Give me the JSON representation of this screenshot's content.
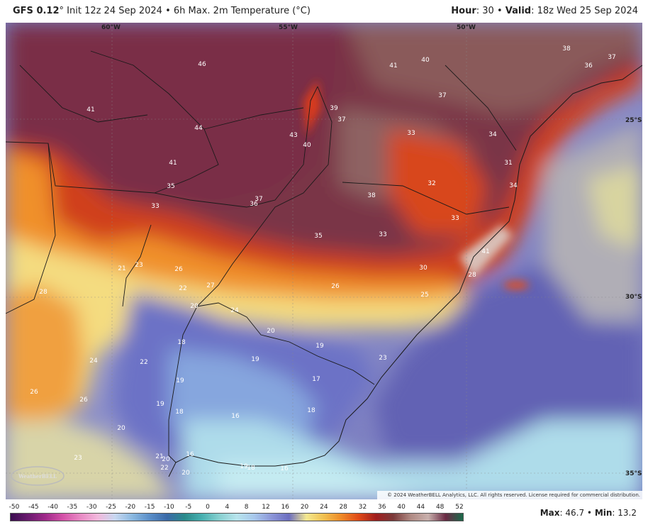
{
  "header": {
    "model": "GFS 0.12",
    "init_text": "° Init 12z 24 Sep 2024 • 6h Max. 2m Temperature (°C)",
    "hour_label": "Hour",
    "hour_value": ": 30 • ",
    "valid_label": "Valid",
    "valid_value": ": 18z Wed 25 Sep 2024"
  },
  "coords": {
    "lon1": "60°W",
    "lon2": "55°W",
    "lon3": "50°W",
    "lat1": "25°S",
    "lat2": "30°S",
    "lat3": "35°S"
  },
  "map_labels": {
    "l1": "46",
    "l2": "41",
    "l3": "40",
    "l4": "38",
    "l5": "37",
    "l6": "36",
    "l7": "41",
    "l8": "39",
    "l9": "37",
    "l10": "37",
    "l11": "44",
    "l12": "43",
    "l13": "40",
    "l14": "33",
    "l15": "34",
    "l16": "41",
    "l17": "35",
    "l18": "33",
    "l19": "31",
    "l20": "37",
    "l21": "36",
    "l22": "38",
    "l23": "32",
    "l24": "34",
    "l25": "33",
    "l26": "35",
    "l27": "33",
    "l28": "41",
    "l29": "21",
    "l30": "23",
    "l31": "26",
    "l32": "30",
    "l33": "28",
    "l34": "28",
    "l35": "22",
    "l36": "27",
    "l37": "26",
    "l38": "25",
    "l39": "20",
    "l40": "24",
    "l41": "20",
    "l42": "18",
    "l43": "19",
    "l44": "19",
    "l45": "24",
    "l46": "22",
    "l47": "23",
    "l48": "19",
    "l49": "17",
    "l50": "26",
    "l51": "26",
    "l52": "19",
    "l53": "18",
    "l54": "16",
    "l55": "18",
    "l56": "20",
    "l57": "23",
    "l58": "21",
    "l59": "20",
    "l60": "16",
    "l61": "22",
    "l62": "19",
    "l63": "18",
    "l64": "16",
    "l65": "20"
  },
  "logo_text": "WeatherBELL",
  "copyright": "© 2024 WeatherBELL Analytics, LLC. All rights reserved. License required for commercial distribution.",
  "colorbar": {
    "ticks": [
      "-50",
      "-45",
      "-40",
      "-35",
      "-30",
      "-25",
      "-20",
      "-15",
      "-10",
      "-5",
      "0",
      "4",
      "8",
      "12",
      "16",
      "20",
      "24",
      "28",
      "32",
      "36",
      "40",
      "44",
      "48",
      "52"
    ],
    "colors": [
      "#3a0d4f",
      "#6a1a6e",
      "#a02a8a",
      "#d452a8",
      "#e889c4",
      "#f2b8dc",
      "#c8d8f0",
      "#8ab8e0",
      "#5a8ec8",
      "#3a6aa8",
      "#2a8a8a",
      "#48b0b0",
      "#88d0d0",
      "#b8e4ec",
      "#a8c8ec",
      "#8c96d8",
      "#6c6ec0",
      "#f4e890",
      "#f0c050",
      "#ee8a28",
      "#e04a18",
      "#a01e1e",
      "#7a3a3a",
      "#b08a84",
      "#c8b0ac",
      "#6a2a44",
      "#1a6a4a"
    ]
  },
  "stats": {
    "max_label": "Max",
    "max_value": ": 46.7 • ",
    "min_label": "Min",
    "min_value": ": 13.2"
  }
}
